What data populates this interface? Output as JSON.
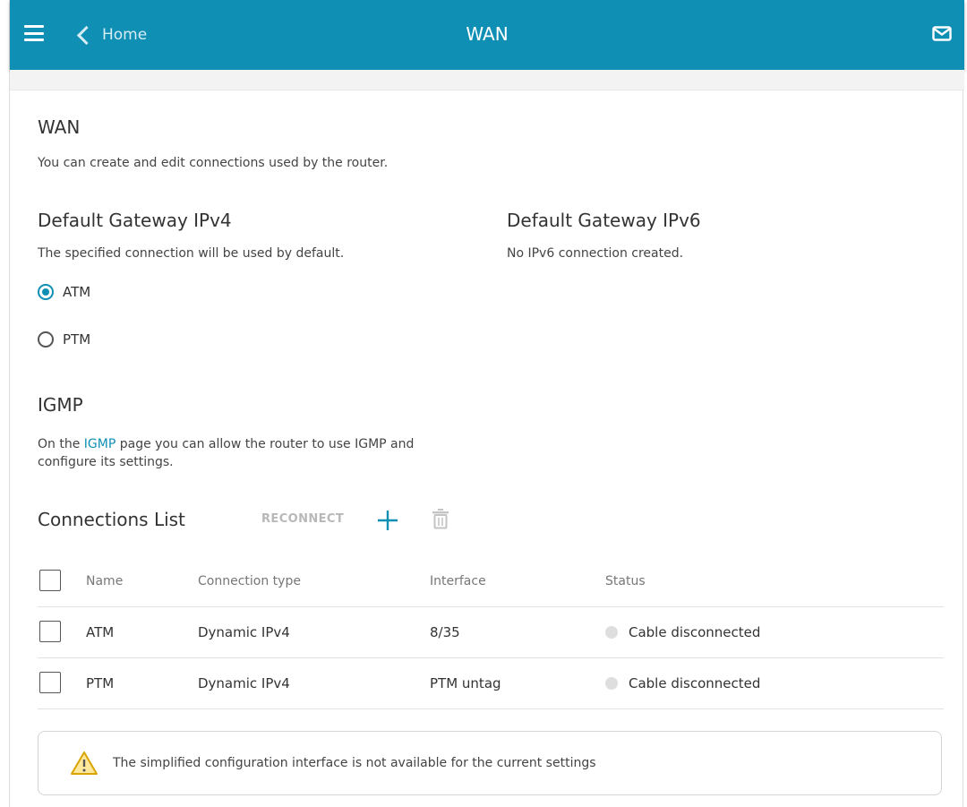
{
  "header": {
    "back_label": "Home",
    "title": "WAN",
    "bar_color": "#0f8fb4"
  },
  "wan": {
    "title": "WAN",
    "description": "You can create and edit connections used by the router."
  },
  "gateway_ipv4": {
    "title": "Default Gateway IPv4",
    "description": "The specified connection will be used by default.",
    "options": [
      {
        "label": "ATM",
        "checked": true
      },
      {
        "label": "PTM",
        "checked": false
      }
    ]
  },
  "gateway_ipv6": {
    "title": "Default Gateway IPv6",
    "description": "No IPv6 connection created."
  },
  "igmp": {
    "title": "IGMP",
    "text_before": "On the ",
    "link": "IGMP",
    "text_after": " page you can allow the router to use IGMP and configure its settings."
  },
  "connections": {
    "title": "Connections List",
    "reconnect_label": "RECONNECT",
    "columns": {
      "name": "Name",
      "type": "Connection type",
      "interface": "Interface",
      "status": "Status"
    },
    "rows": [
      {
        "name": "ATM",
        "type": "Dynamic IPv4",
        "interface": "8/35",
        "status": "Cable disconnected"
      },
      {
        "name": "PTM",
        "type": "Dynamic IPv4",
        "interface": "PTM untag",
        "status": "Cable disconnected"
      }
    ]
  },
  "notice": {
    "icon": "warning-icon",
    "text": "The simplified configuration interface is not available for the current settings"
  }
}
